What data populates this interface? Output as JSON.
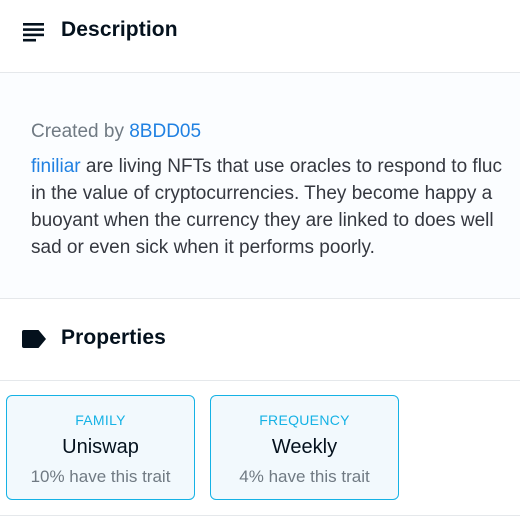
{
  "description": {
    "header_title": "Description",
    "created_prefix": "Created by",
    "creator": "8BDD05",
    "link_word": "finiliar",
    "line1_rest": " are living NFTs that use oracles to respond to fluc",
    "line2": "in the value of cryptocurrencies. They become happy a",
    "line3": "buoyant when the currency they are linked to does well",
    "line4": "sad or even sick when it performs poorly."
  },
  "properties": {
    "header_title": "Properties",
    "traits": [
      {
        "type": "FAMILY",
        "value": "Uniswap",
        "rarity": "10% have this trait"
      },
      {
        "type": "FREQUENCY",
        "value": "Weekly",
        "rarity": "4% have this trait"
      }
    ]
  },
  "icons": {
    "description": "subject-lines-icon",
    "properties": "label-tag-icon"
  },
  "colors": {
    "link": "#2081e2",
    "trait_accent": "#15b2e5",
    "trait_bg": "#f2f9fd",
    "text_primary": "#04111d",
    "text_secondary": "#707a83"
  }
}
